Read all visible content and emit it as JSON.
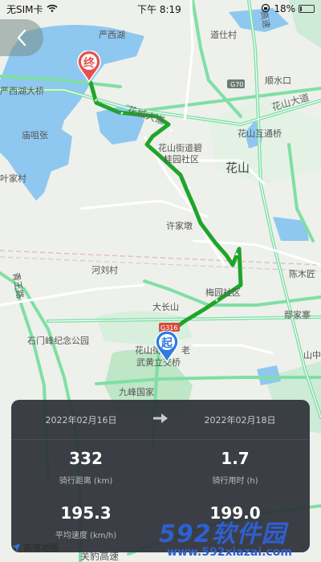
{
  "status_bar": {
    "carrier": "无SIM卡",
    "time": "下午 8:19",
    "battery": "18%"
  },
  "map": {
    "labels": {
      "yanxi_lake": "严西湖",
      "daoshi_village": "道仕村",
      "yanxi_bridge": "严西湖大桥",
      "miaoxiang": "庙咀张",
      "huacheng_road": "花城大道",
      "huashan_road": "花山大道",
      "huashan_interchange": "花山互通桥",
      "huashan_community": "花山街道碧",
      "guiyuan_community": "桂园社区",
      "huashan": "花山",
      "yejia_village": "叶家村",
      "xujiadun": "许家墩",
      "hejiacun": "河刘村",
      "chendong": "陈木匠",
      "qingwang_road": "青王路",
      "dachangshan": "大长山",
      "meiyuan_community": "梅园社区",
      "guojiazhai": "鄢家寨",
      "shimen_park": "石门峰纪念公园",
      "huashan_street": "花山街道",
      "wuhuang_bridge": "武黄立交桥",
      "jiufeng": "九峰国家",
      "shuikou": "顺水口",
      "g70": "G70",
      "g316": "G316",
      "gaosu": "高速",
      "shanzhong": "山中",
      "tieqiao": "老"
    },
    "end_marker": "终",
    "start_marker": "起"
  },
  "panel": {
    "start_date": "2022年02月16日",
    "end_date": "2022年02月18日",
    "stats": [
      {
        "value": "332",
        "label": "骑行距离 (km)"
      },
      {
        "value": "1.7",
        "label": "骑行用时 (h)"
      },
      {
        "value": "195.3",
        "label": "平均速度 (km/h)"
      },
      {
        "value": "199.0",
        "label": ""
      }
    ]
  },
  "footer": {
    "logo": "高德地图",
    "road": "关豹高速"
  },
  "watermark": {
    "title": "592软件园",
    "url": "www.592xiazai.com"
  },
  "colors": {
    "route": "#1fa52a",
    "end_pin": "#e8504f",
    "start_pin": "#2f7be0",
    "water": "#8ec8f0",
    "highway": "#7fdfa4"
  }
}
